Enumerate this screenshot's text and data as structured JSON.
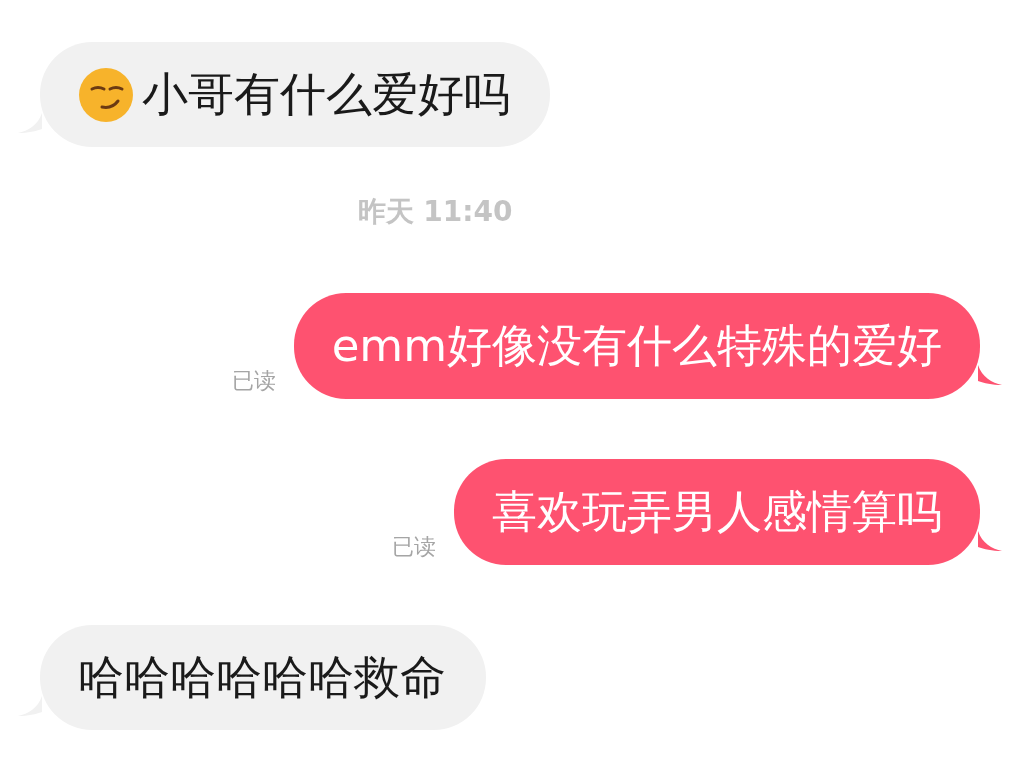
{
  "messages": [
    {
      "kind": "incoming",
      "emoji": true,
      "text": "小哥有什么爱好吗"
    },
    {
      "kind": "timestamp",
      "text": "昨天 11:40"
    },
    {
      "kind": "outgoing",
      "text": "emm好像没有什么特殊的爱好",
      "receipt": "已读"
    },
    {
      "kind": "outgoing",
      "text": "喜欢玩弄男人感情算吗",
      "receipt": "已读"
    },
    {
      "kind": "incoming",
      "text": "哈哈哈哈哈哈救命"
    }
  ]
}
